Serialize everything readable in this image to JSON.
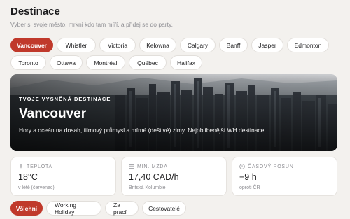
{
  "header": {
    "title": "Destinace",
    "subtitle": "Vyber si svoje město, mrkni kdo tam míří, a přidej se do party."
  },
  "cities_row1": [
    "Vancouver",
    "Whistler",
    "Victoria",
    "Kelowna",
    "Calgary",
    "Banff",
    "Jasper",
    "Edmonton"
  ],
  "cities_row2": [
    "Toronto",
    "Ottawa",
    "Montréal",
    "Québec",
    "Halifax"
  ],
  "selected_city": "Vancouver",
  "hero": {
    "kicker": "TVOJE VYSNĚNÁ DESTINACE",
    "city": "Vancouver",
    "description": "Hory a oceán na dosah, filmový průmysl a mírné (deštivé) zimy. Nejoblíbenější WH destinace."
  },
  "stats": [
    {
      "label": "TEPLOTA",
      "value": "18°C",
      "note": "v létě (červenec)",
      "icon": "thermometer-icon"
    },
    {
      "label": "MIN. MZDA",
      "value": "17,40 CAD/h",
      "note": "Britská Kolumbie",
      "icon": "card-icon"
    },
    {
      "label": "ČASOVÝ POSUN",
      "value": "−9 h",
      "note": "oproti ČR",
      "icon": "clock-icon"
    }
  ],
  "filters": [
    "Všichni",
    "Working Holiday",
    "Za prací",
    "Cestovatelé"
  ],
  "selected_filter": "Všichni",
  "colors": {
    "accent": "#c0392b",
    "background": "#f3f1ee"
  }
}
